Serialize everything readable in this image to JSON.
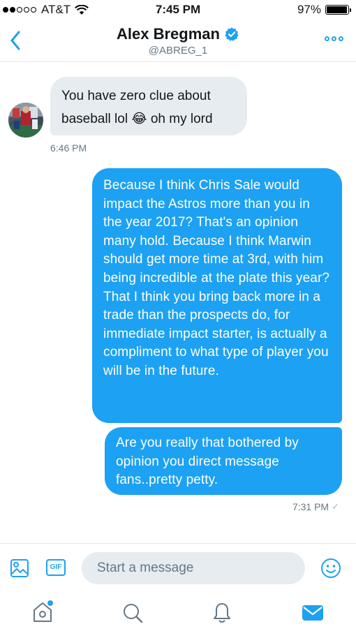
{
  "status_bar": {
    "carrier": "AT&T",
    "time": "7:45 PM",
    "battery": "97%",
    "battery_level": 0.97
  },
  "header": {
    "name": "Alex Bregman",
    "handle": "@ABREG_1",
    "verified": true
  },
  "messages": [
    {
      "direction": "incoming",
      "text_parts": [
        "You have zero clue about baseball lol ",
        "😂",
        " oh my lord"
      ],
      "timestamp": "6:46 PM"
    },
    {
      "direction": "outgoing",
      "text": "Because I think Chris Sale would impact the Astros more than you in the year 2017? That's an opinion many hold. Because I think Marwin should get more time at 3rd, with him being incredible at the plate this year? That I think you bring back more in a trade than the prospects do, for immediate impact starter, is actually a compliment to what type of player you will be in the future."
    },
    {
      "direction": "outgoing",
      "text": "Are you really that bothered by opinion you direct message fans..pretty petty.",
      "timestamp": "7:31 PM",
      "read_receipt": "✓"
    }
  ],
  "composer": {
    "placeholder": "Start a message",
    "gif_label": "GIF"
  },
  "colors": {
    "accent": "#1da1f2",
    "incoming_bubble": "#e6ecf0",
    "secondary_text": "#657786"
  },
  "tabbar": {
    "items": [
      "home-icon",
      "search-icon",
      "notifications-icon",
      "messages-icon"
    ],
    "active": "messages-icon"
  }
}
